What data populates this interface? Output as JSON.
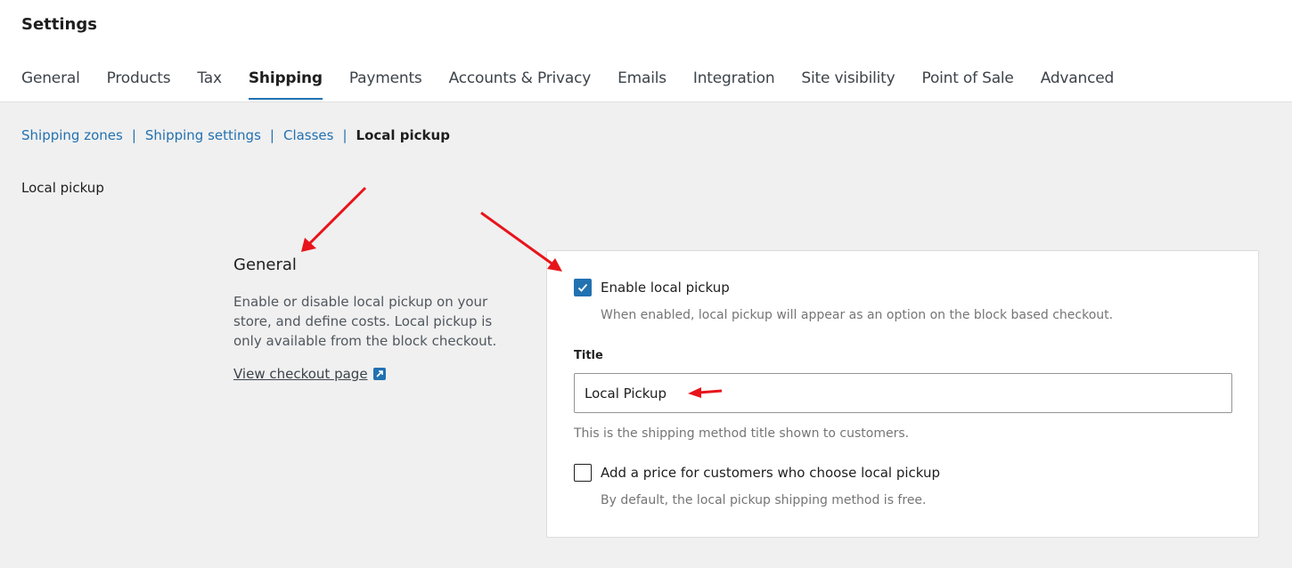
{
  "header": {
    "title": "Settings"
  },
  "tabs": [
    {
      "label": "General",
      "active": false
    },
    {
      "label": "Products",
      "active": false
    },
    {
      "label": "Tax",
      "active": false
    },
    {
      "label": "Shipping",
      "active": true
    },
    {
      "label": "Payments",
      "active": false
    },
    {
      "label": "Accounts & Privacy",
      "active": false
    },
    {
      "label": "Emails",
      "active": false
    },
    {
      "label": "Integration",
      "active": false
    },
    {
      "label": "Site visibility",
      "active": false
    },
    {
      "label": "Point of Sale",
      "active": false
    },
    {
      "label": "Advanced",
      "active": false
    }
  ],
  "subnav": {
    "items": [
      "Shipping zones",
      "Shipping settings",
      "Classes"
    ],
    "separator": "|",
    "current": "Local pickup"
  },
  "section_label": "Local pickup",
  "general": {
    "heading": "General",
    "description": "Enable or disable local pickup on your store, and define costs. Local pickup is only available from the block checkout.",
    "link_label": "View checkout page",
    "link_icon": "external-link-icon"
  },
  "form": {
    "enable": {
      "label": "Enable local pickup",
      "checked": true,
      "help": "When enabled, local pickup will appear as an option on the block based checkout."
    },
    "title": {
      "label": "Title",
      "value": "Local Pickup",
      "help": "This is the shipping method title shown to customers."
    },
    "price": {
      "label": "Add a price for customers who choose local pickup",
      "checked": false,
      "help": "By default, the local pickup shipping method is free."
    }
  },
  "colors": {
    "accent": "#2271b1",
    "annotation": "#e8141b",
    "background": "#f0f0f0"
  }
}
